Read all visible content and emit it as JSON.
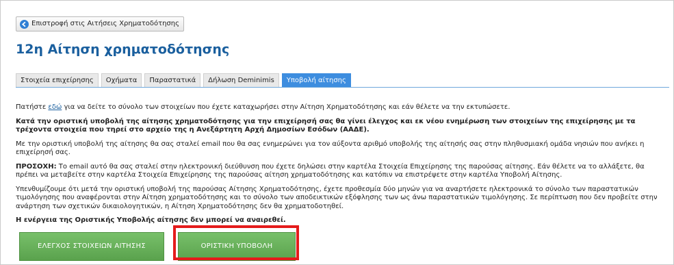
{
  "back_button": {
    "label": "Επιστροφή στις Αιτήσεις Χρηματοδότησης",
    "icon": "back-arrow-icon"
  },
  "page": {
    "title": "12η Αίτηση χρηματοδότησης"
  },
  "tabs": [
    {
      "label": "Στοιχεία επιχείρησης",
      "active": false
    },
    {
      "label": "Οχήματα",
      "active": false
    },
    {
      "label": "Παραστατικά",
      "active": false
    },
    {
      "label": "Δήλωση Deminimis",
      "active": false
    },
    {
      "label": "Υποβολή αίτησης",
      "active": true
    }
  ],
  "content": {
    "p1_before": "Πατήστε ",
    "p1_link": "εδώ",
    "p1_after": " για να δείτε το σύνολο των στοιχείων που έχετε καταχωρήσει στην Αίτηση Χρηματοδότησης και εάν θέλετε να την εκτυπώσετε.",
    "p2": "Κατά την οριστική υποβολή της αίτησης χρηματοδότησης για την επιχείρησή σας θα γίνει έλεγχος και εκ νέου ενημέρωση των στοιχείων της επιχείρησης με τα τρέχοντα στοιχεία που τηρεί στο αρχείο της η Ανεξάρτητη Αρχή Δημοσίων Εσόδων (ΑΑΔΕ).",
    "p3": "Με την οριστική υποβολή της αίτησης θα σας σταλεί email που θα σας ενημερώνει για τον αύξοντα αριθμό υποβολής της αίτησής σας στην πληθυσμιακή ομάδα νησιών που ανήκει η επιχείρησή σας.",
    "p4_label": "ΠΡΟΣΟΧΗ:",
    "p4_text": " Το email αυτό θα σας σταλεί στην ηλεκτρονική διεύθυνση που έχετε δηλώσει στην καρτέλα Στοιχεία Επιχείρησης της παρούσας αίτησης. Εάν θέλετε να το αλλάξετε, θα πρέπει να μεταβείτε στην καρτέλα Στοιχεία Επιχείρησης της παρούσας αίτηση χρηματοδότησης και κατόπιν να επιστρέψετε στην καρτέλα Υποβολή Αίτησης.",
    "p5": "Υπενθυμίζουμε ότι μετά την οριστική υποβολή της παρούσας Αίτησης Χρηματοδότησης, έχετε προθεσμία δύο μηνών για να αναρτήσετε ηλεκτρονικά το σύνολο των παραστατικών τιμολόγησης που αναφέρονται στην Αίτηση χρηματοδότησης και το σύνολο των αποδεικτικών εξόφλησης των ως άνω παραστατικών τιμολόγησης. Σε περίπτωση που δεν προβείτε στην ανάρτηση των σχετικών δικαιολογητικών, η Αίτηση Χρηματοδότησης δεν θα χρηματοδοτηθεί.",
    "p6": "Η ενέργεια της Οριστικής Υποβολής αίτησης δεν μπορεί να αναιρεθεί."
  },
  "actions": {
    "check_label": "ΕΛΕΓΧΟΣ ΣΤΟΙΧΕΙΩΝ ΑΙΤΗΣΗΣ",
    "submit_label": "ΟΡΙΣΤΙΚΗ ΥΠΟΒΟΛΗ"
  },
  "colors": {
    "title": "#1a5f9e",
    "active_tab": "#3d8ddf",
    "action_button": "#68b25b",
    "highlight_border": "#e41b1b"
  }
}
